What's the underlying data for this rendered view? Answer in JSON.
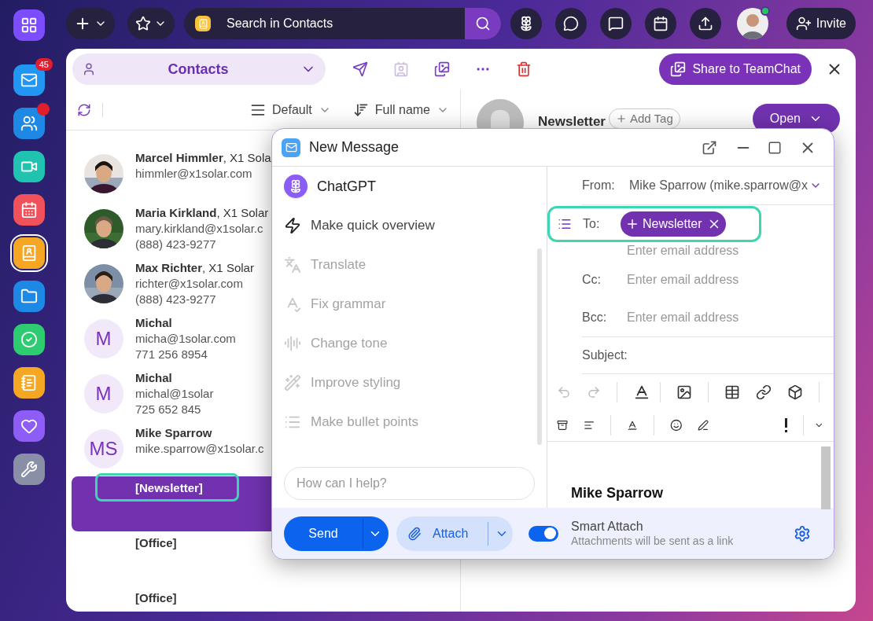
{
  "dock": [
    {
      "selected": false
    },
    {
      "selected": false,
      "badge": "45"
    },
    {
      "selected": false,
      "dot": true
    },
    {
      "selected": false
    },
    {
      "selected": false
    },
    {
      "selected": true
    },
    {
      "selected": false
    },
    {
      "selected": false
    },
    {
      "selected": false
    },
    {
      "selected": false
    },
    {
      "selected": false
    }
  ],
  "topbar": {
    "search_placeholder": "Search in Contacts",
    "invite": "Invite",
    "online": true
  },
  "contacts_header": {
    "title": "Contacts",
    "share": "Share to TeamChat",
    "tools": [
      {
        "disabled": false
      },
      {
        "disabled": true
      },
      {
        "disabled": false
      },
      {
        "disabled": false
      },
      {
        "disabled": false
      }
    ]
  },
  "list_toolbar": {
    "view": "Default",
    "sort": "Full name"
  },
  "contacts": [
    {
      "name": "Marcel Himmler",
      "company": ", X1 Sola",
      "lines": [
        "himmler@x1solar.com"
      ],
      "selected": false
    },
    {
      "name": "Maria Kirkland",
      "company": ", X1 Solar",
      "lines": [
        "mary.kirkland@x1solar.c",
        "(888) 423-9277"
      ],
      "selected": false
    },
    {
      "name": "Max Richter",
      "company": ", X1 Solar",
      "lines": [
        "richter@x1solar.com",
        "(888) 423-9277"
      ],
      "selected": false
    },
    {
      "kind": "initials",
      "initials": "M",
      "name": "Michal",
      "lines": [
        "micha@1solar.com",
        "771 256 8954"
      ],
      "selected": false
    },
    {
      "kind": "initials",
      "initials": "M",
      "name": "Michal",
      "lines": [
        "michal@1solar",
        "725 652 845"
      ],
      "selected": false
    },
    {
      "kind": "initials",
      "initials": "MS",
      "name": "Mike Sparrow",
      "lines": [
        "mike.sparrow@x1solar.c"
      ],
      "selected": false
    },
    {
      "kind": "group",
      "name": "[Newsletter]",
      "selected": true,
      "highlighted": true
    },
    {
      "kind": "group",
      "name": "[Office]",
      "selected": false
    },
    {
      "kind": "group",
      "name": "[Office]",
      "selected": false
    }
  ],
  "detail": {
    "name": "Newsletter",
    "add_tag": "Add Tag",
    "open": "Open"
  },
  "compose": {
    "title": "New Message",
    "assistant": {
      "title": "ChatGPT",
      "actions": [
        {
          "label": "Make quick overview",
          "disabled": false
        },
        {
          "label": "Translate",
          "disabled": true
        },
        {
          "label": "Fix grammar",
          "disabled": true
        },
        {
          "label": "Change tone",
          "disabled": true
        },
        {
          "label": "Improve styling",
          "disabled": true
        },
        {
          "label": "Make bullet points",
          "disabled": true
        }
      ],
      "placeholder": "How can I help?"
    },
    "from_label": "From:",
    "from": "Mike Sparrow (mike.sparrow@x",
    "to_label": "To:",
    "to_chip": "Newsletter",
    "to_highlighted": true,
    "to_placeholder": "Enter email address",
    "cc_label": "Cc:",
    "cc_placeholder": "Enter email address",
    "bcc_label": "Bcc:",
    "bcc_placeholder": "Enter email address",
    "subject_label": "Subject:",
    "signature": "Mike Sparrow",
    "send": "Send",
    "attach": "Attach",
    "smart_attach": {
      "on": true,
      "title": "Smart Attach",
      "subtitle": "Attachments will be sent as a link"
    }
  }
}
